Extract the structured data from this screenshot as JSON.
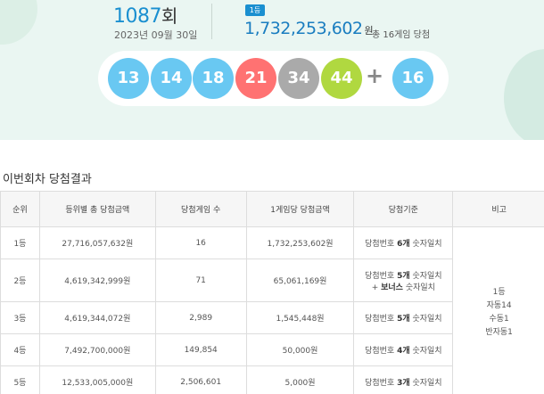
{
  "draw": {
    "round_number": "1087",
    "round_suffix": "회",
    "date": "2023년 09월 30일",
    "first_prize_badge": "1등",
    "first_prize_amount": "1,732,253,602",
    "first_prize_unit": "원",
    "winners_text": "총 16게임 당첨",
    "numbers": [
      "13",
      "14",
      "18",
      "21",
      "34",
      "44"
    ],
    "plus": "+",
    "bonus": "16",
    "ball_colors": [
      "#69c8f2",
      "#69c8f2",
      "#69c8f2",
      "#ff7272",
      "#aaaaaa",
      "#b0d840"
    ],
    "bonus_color": "#69c8f2"
  },
  "results": {
    "title": "이번회차 당첨결과",
    "headers": [
      "순위",
      "등위별 총 당첨금액",
      "당첨게임 수",
      "1게임당 당첨금액",
      "당첨기준",
      "비고"
    ],
    "rows": [
      {
        "rank": "1등",
        "total": "27,716,057,632원",
        "games": "16",
        "per_game": "1,732,253,602원",
        "criteria_pre": "당첨번호 ",
        "criteria_bold": "6개",
        "criteria_post": " 숫자일치",
        "criteria2_pre": "",
        "criteria2_bold": "",
        "criteria2_post": ""
      },
      {
        "rank": "2등",
        "total": "4,619,342,999원",
        "games": "71",
        "per_game": "65,061,169원",
        "criteria_pre": "당첨번호 ",
        "criteria_bold": "5개",
        "criteria_post": " 숫자일치",
        "criteria2_pre": "+ ",
        "criteria2_bold": "보너스",
        "criteria2_post": " 숫자일치"
      },
      {
        "rank": "3등",
        "total": "4,619,344,072원",
        "games": "2,989",
        "per_game": "1,545,448원",
        "criteria_pre": "당첨번호 ",
        "criteria_bold": "5개",
        "criteria_post": " 숫자일치",
        "criteria2_pre": "",
        "criteria2_bold": "",
        "criteria2_post": ""
      },
      {
        "rank": "4등",
        "total": "7,492,700,000원",
        "games": "149,854",
        "per_game": "50,000원",
        "criteria_pre": "당첨번호 ",
        "criteria_bold": "4개",
        "criteria_post": " 숫자일치",
        "criteria2_pre": "",
        "criteria2_bold": "",
        "criteria2_post": ""
      },
      {
        "rank": "5등",
        "total": "12,533,005,000원",
        "games": "2,506,601",
        "per_game": "5,000원",
        "criteria_pre": "당첨번호 ",
        "criteria_bold": "3개",
        "criteria_post": " 숫자일치",
        "criteria2_pre": "",
        "criteria2_bold": "",
        "criteria2_post": ""
      }
    ],
    "note_lines": [
      "1등",
      "자동14",
      "수동1",
      "반자동1"
    ]
  }
}
